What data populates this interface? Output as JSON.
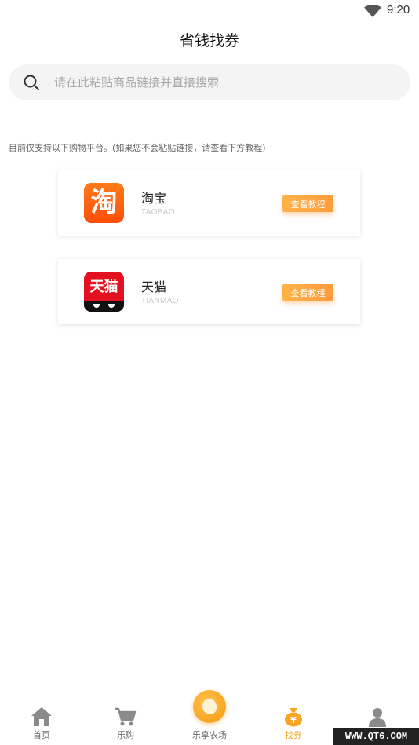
{
  "status_bar": {
    "time": "9:20",
    "wifi_icon": "wifi-icon"
  },
  "header": {
    "title": "省钱找券"
  },
  "search": {
    "placeholder": "请在此粘贴商品链接并直接搜索",
    "icon": "search-icon"
  },
  "notice": "目前仅支持以下购物平台。(如果您不会粘贴链接，请查看下方教程)",
  "platforms": [
    {
      "name": "淘宝",
      "sub": "TAOBAO",
      "logo_text": "淘",
      "button": "查看教程",
      "color": "#ff5a00"
    },
    {
      "name": "天猫",
      "sub": "TIANMAO",
      "logo_text": "天猫",
      "button": "查看教程",
      "color": "#e3101f"
    }
  ],
  "tabbar": {
    "items": [
      {
        "label": "首页",
        "icon": "home-icon"
      },
      {
        "label": "乐购",
        "icon": "cart-icon"
      },
      {
        "label": "乐享农场",
        "icon": "bean-icon"
      },
      {
        "label": "找券",
        "icon": "money-bag-icon",
        "active": true
      },
      {
        "label": "",
        "icon": "user-icon"
      }
    ],
    "active_color": "#f5a623"
  },
  "watermark": "WWW.QT6.COM"
}
